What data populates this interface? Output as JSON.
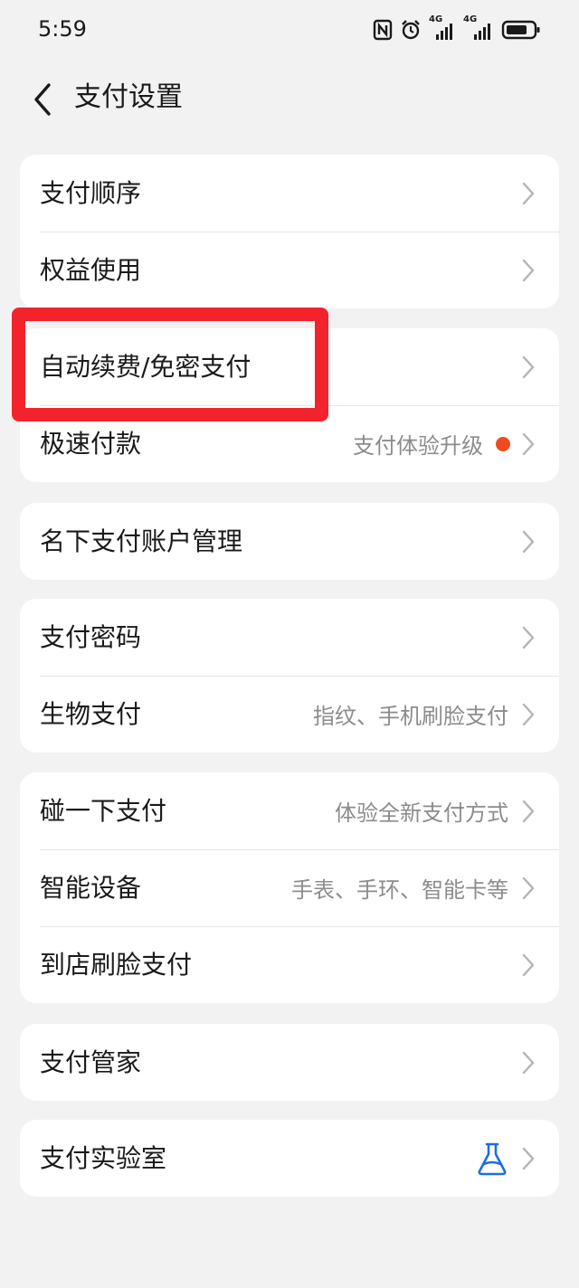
{
  "status_bar": {
    "time": "5:59",
    "network_1": "4G",
    "network_2": "4G",
    "icons": [
      "nfc-icon",
      "alarm-icon",
      "signal-icon",
      "signal-icon",
      "battery-icon"
    ]
  },
  "header": {
    "title": "支付设置",
    "back_icon": "chevron-left-icon"
  },
  "groups": [
    {
      "items": [
        {
          "label": "支付顺序"
        },
        {
          "label": "权益使用"
        }
      ]
    },
    {
      "items": [
        {
          "label": "自动续费/免密支付"
        },
        {
          "label": "极速付款",
          "value": "支付体验升级",
          "badge_color": "#f04a24"
        }
      ]
    },
    {
      "items": [
        {
          "label": "名下支付账户管理"
        }
      ]
    },
    {
      "items": [
        {
          "label": "支付密码"
        },
        {
          "label": "生物支付",
          "value": "指纹、手机刷脸支付"
        }
      ]
    },
    {
      "items": [
        {
          "label": "碰一下支付",
          "value": "体验全新支付方式"
        },
        {
          "label": "智能设备",
          "value": "手表、手环、智能卡等"
        },
        {
          "label": "到店刷脸支付"
        }
      ]
    },
    {
      "items": [
        {
          "label": "支付管家"
        }
      ]
    },
    {
      "items": [
        {
          "label": "支付实验室",
          "icon": "flask-icon",
          "icon_color": "#1e6fd9"
        }
      ]
    }
  ],
  "highlight": {
    "color": "#f2232c"
  }
}
